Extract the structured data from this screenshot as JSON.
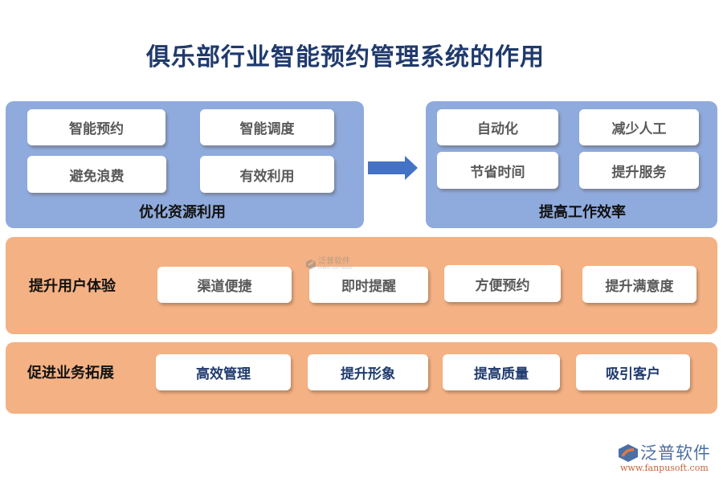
{
  "title": "俱乐部行业智能预约管理系统的作用",
  "colors": {
    "title": "#1f3a6d",
    "blue_panel": "#8faadc",
    "orange_panel": "#f4b183",
    "arrow": "#4472c4",
    "card": "#ffffff",
    "card_text_gray": "#595959",
    "card_text_navy": "#1f3a6d"
  },
  "optimize": {
    "caption": "优化资源利用",
    "items": [
      "智能预约",
      "智能调度",
      "避免浪费",
      "有效利用"
    ]
  },
  "efficiency": {
    "caption": "提高工作效率",
    "items": [
      "自动化",
      "减少人工",
      "节省时间",
      "提升服务"
    ]
  },
  "arrow_icon": "right-arrow-icon",
  "user_experience": {
    "label": "提升用户体验",
    "items": [
      "渠道便捷",
      "即时提醒",
      "方便预约",
      "提升满意度"
    ]
  },
  "business": {
    "label": "促进业务拓展",
    "items": [
      "高效管理",
      "提升形象",
      "提高质量",
      "吸引客户"
    ]
  },
  "watermark": {
    "name": "泛普软件",
    "sub": "FANPU SOFTWARE"
  },
  "logo": {
    "name": "泛普软件",
    "url": "www.fanpusoft.com"
  }
}
